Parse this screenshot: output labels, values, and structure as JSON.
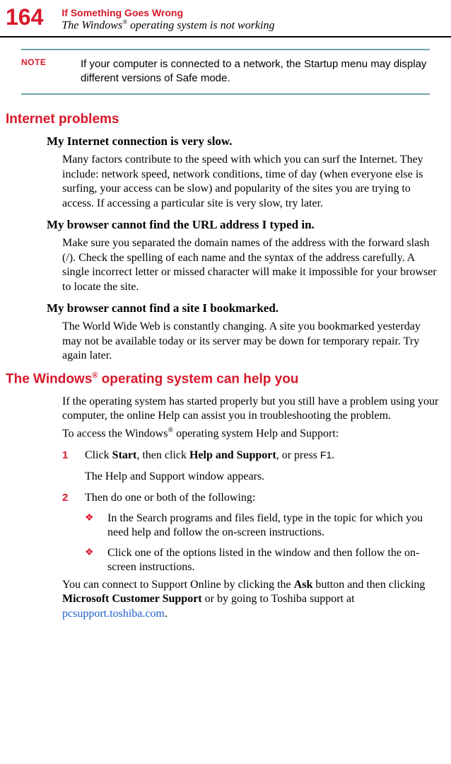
{
  "header": {
    "pageNumber": "164",
    "chapterTitle": "If Something Goes Wrong",
    "sectionTitle_before": "The Windows",
    "sectionTitle_sup": "®",
    "sectionTitle_after": " operating system is not working"
  },
  "note": {
    "label": "NOTE",
    "text": "If your computer is connected to a network, the Startup menu may display different versions of Safe mode."
  },
  "sections": {
    "internet": {
      "heading": "Internet problems",
      "sub1_title": "My Internet connection is very slow.",
      "sub1_body": "Many factors contribute to the speed with which you can surf the Internet. They include: network speed, network conditions, time of day (when everyone else is surfing, your access can be slow) and popularity of the sites you are trying to access. If accessing a particular site is very slow, try later.",
      "sub2_title": "My browser cannot find the URL address I typed in.",
      "sub2_body": "Make sure you separated the domain names of the address with the forward slash (/). Check the spelling of each name and the syntax of the address carefully. A single incorrect letter or missed character will make it impossible for your browser to locate the site.",
      "sub3_title": "My browser cannot find a site I bookmarked.",
      "sub3_body": "The World Wide Web is constantly changing. A site you bookmarked yesterday may not be available today or its server may be down for temporary repair. Try again later."
    },
    "windows": {
      "heading_before": "The Windows",
      "heading_sup": "®",
      "heading_after": " operating system can help you",
      "intro": "If the operating system has started properly but you still have a problem using your computer, the online Help can assist you in troubleshooting the problem.",
      "access_before": "To access the Windows",
      "access_sup": "®",
      "access_after": " operating system Help and Support:",
      "step1_num": "1",
      "step1_a": "Click ",
      "step1_b1": "Start",
      "step1_c": ", then click ",
      "step1_b2": "Help and Support",
      "step1_d": ", or press ",
      "step1_key": "F1",
      "step1_e": ".",
      "step1_extra": "The Help and Support window appears.",
      "step2_num": "2",
      "step2_text": "Then do one or both of the following:",
      "bullet_glyph": "❖",
      "bullet1": "In the Search programs and files field, type in the topic for which you need help and follow the on-screen instructions.",
      "bullet2": "Click one of the options listed in the window and then follow the on-screen instructions.",
      "final_a": "You can connect to Support Online by clicking the ",
      "final_b1": "Ask",
      "final_c": " button and then clicking ",
      "final_b2": "Microsoft Customer Support",
      "final_d": " or by going to Toshiba support at ",
      "final_link": "pcsupport.toshiba.com",
      "final_e": "."
    }
  }
}
